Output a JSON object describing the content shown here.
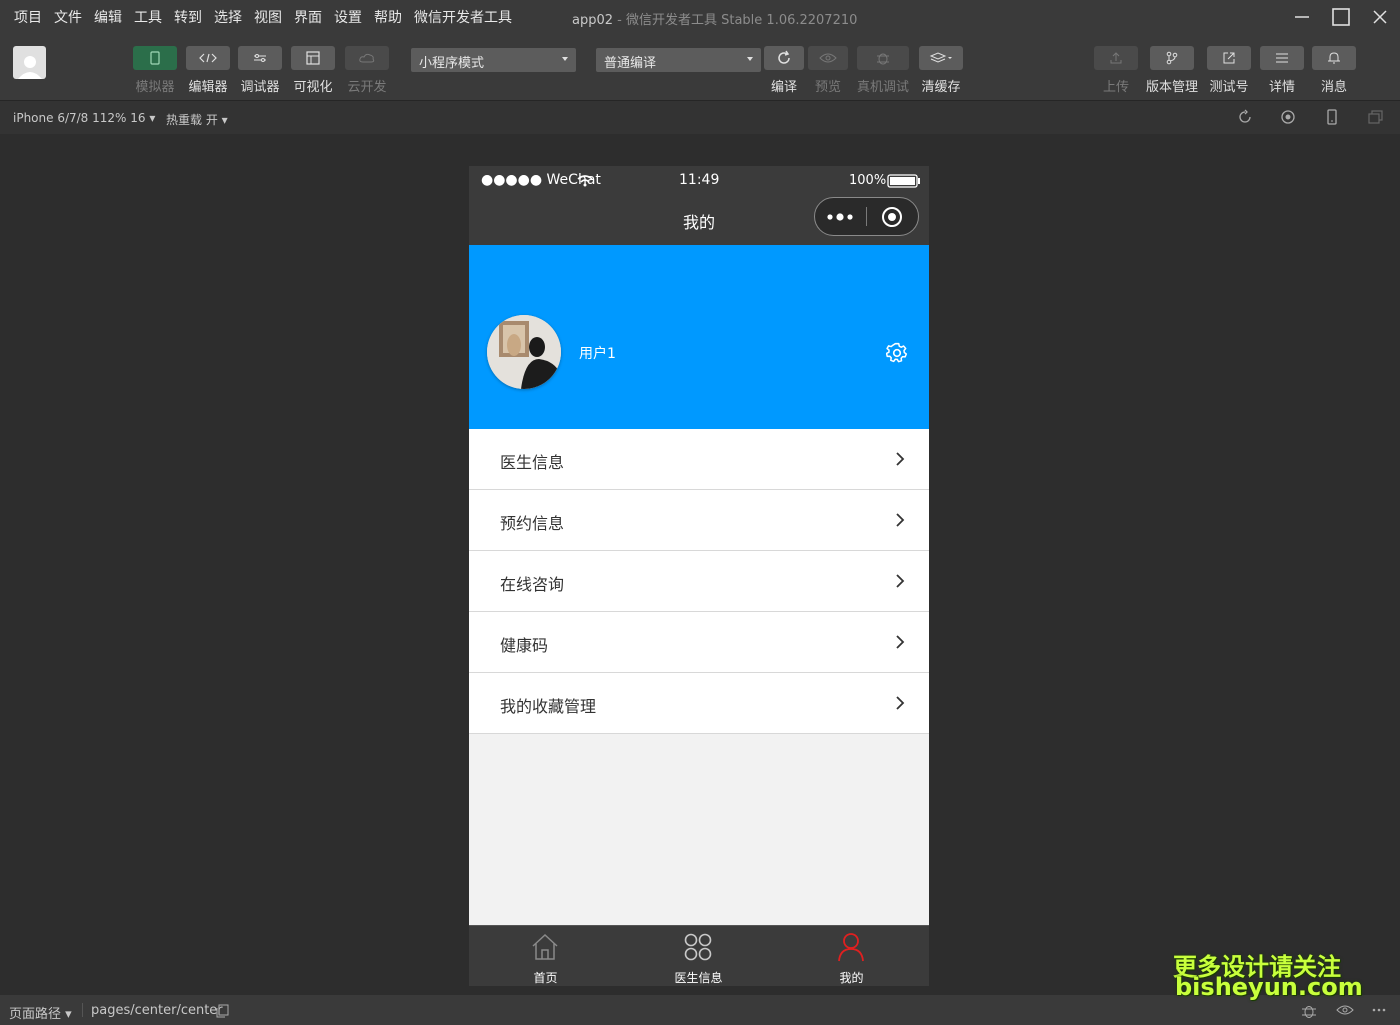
{
  "window": {
    "menu": [
      "项目",
      "文件",
      "编辑",
      "工具",
      "转到",
      "选择",
      "视图",
      "界面",
      "设置",
      "帮助",
      "微信开发者工具"
    ],
    "title_app": "app02",
    "title_rest": "- 微信开发者工具 Stable 1.06.2207210"
  },
  "toolbar": {
    "simulator": "模拟器",
    "editor": "编辑器",
    "debugger": "调试器",
    "visual": "可视化",
    "cloud": "云开发",
    "mode_select": "小程序模式",
    "compile_select": "普通编译",
    "compile": "编译",
    "preview": "预览",
    "real_debug": "真机调试",
    "clear_cache": "清缓存",
    "upload": "上传",
    "version": "版本管理",
    "test_account": "测试号",
    "details": "详情",
    "messages": "消息"
  },
  "subbar": {
    "device": "iPhone 6/7/8 112% 16 ▾",
    "hot_reload": "热重载 开 ▾"
  },
  "phone": {
    "carrier": "●●●●● WeChat",
    "time": "11:49",
    "battery": "100%",
    "nav_title": "我的",
    "username": "用户1",
    "menu_items": [
      {
        "label": "医生信息"
      },
      {
        "label": "预约信息"
      },
      {
        "label": "在线咨询"
      },
      {
        "label": "健康码"
      },
      {
        "label": "我的收藏管理"
      }
    ],
    "tabs": [
      {
        "label": "首页"
      },
      {
        "label": "医生信息"
      },
      {
        "label": "我的"
      }
    ],
    "hero_color": "#0099ff",
    "active_tab_color": "#e02020"
  },
  "statusbar": {
    "path_label": "页面路径 ▾",
    "path": "pages/center/center"
  },
  "watermark": {
    "line1": "更多设计请关注",
    "line2": "bisheyun.com"
  }
}
